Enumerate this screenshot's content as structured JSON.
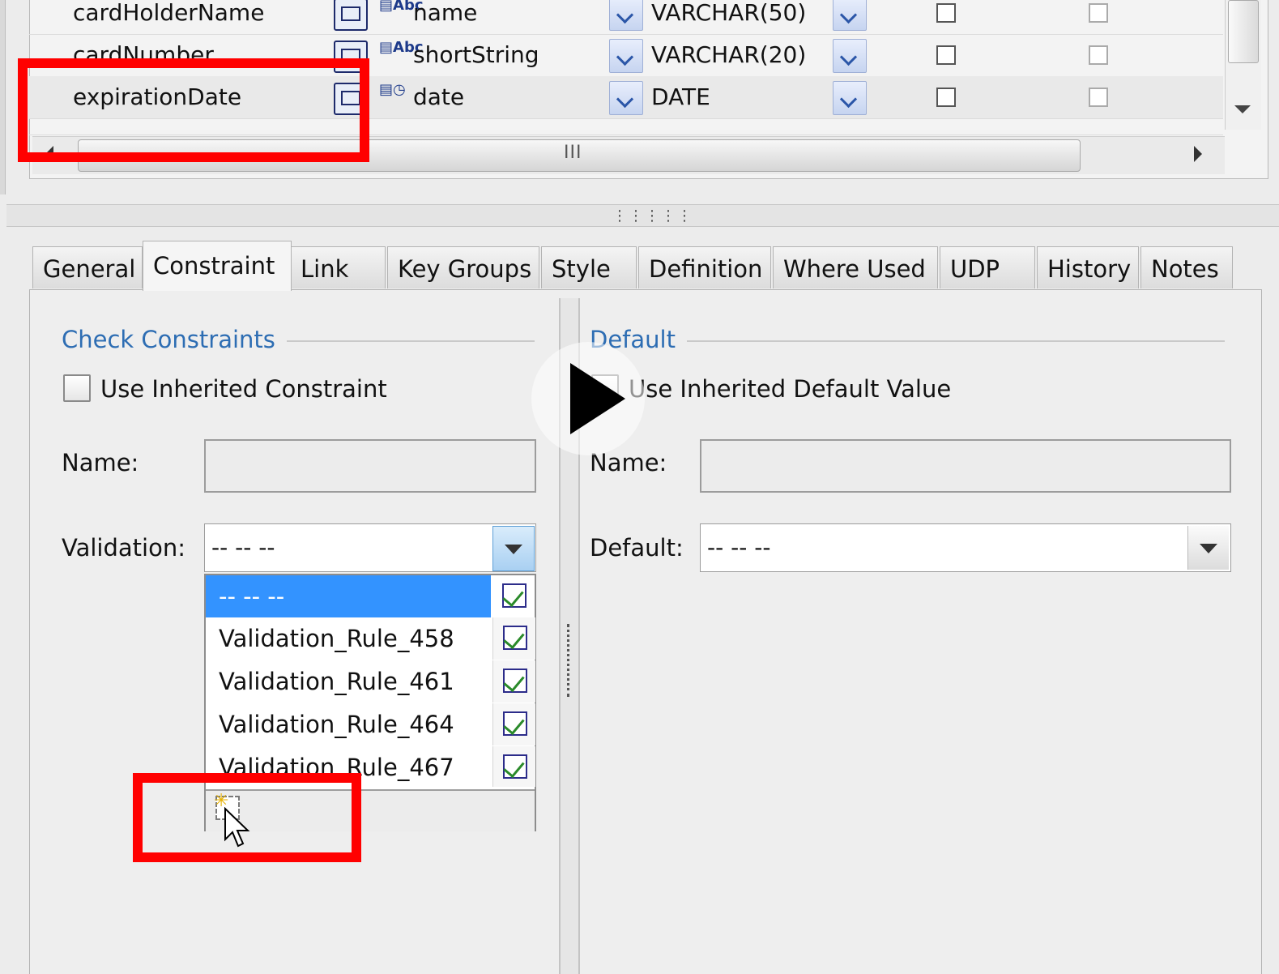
{
  "grid": {
    "rows": [
      {
        "name": "cardHolderName",
        "domain": "name",
        "datatype": "VARCHAR(50)"
      },
      {
        "name": "cardNumber",
        "domain": "shortString",
        "datatype": "VARCHAR(20)"
      },
      {
        "name": "expirationDate",
        "domain": "date",
        "datatype": "DATE"
      }
    ],
    "hscroll_grip": "III"
  },
  "tabs": [
    "General",
    "Constraint",
    "Link",
    "Key Groups",
    "Style",
    "Definition",
    "Where Used",
    "UDP",
    "History",
    "Notes"
  ],
  "active_tab": "Constraint",
  "check_constraints": {
    "title": "Check Constraints",
    "inherit_label": "Use Inherited Constraint",
    "name_label": "Name:",
    "name_value": "",
    "validation_label": "Validation:",
    "validation_value": "-- -- --",
    "options": [
      "-- -- --",
      "Validation_Rule_458",
      "Validation_Rule_461",
      "Validation_Rule_464",
      "Validation_Rule_467"
    ]
  },
  "default": {
    "title": "Default",
    "inherit_label": "Use Inherited Default Value",
    "name_label": "Name:",
    "name_value": "",
    "default_label": "Default:",
    "default_value": "-- -- --"
  },
  "icons": [
    "column-icon",
    "domain-text-icon",
    "domain-date-icon",
    "dropdown-arrow-icon",
    "edit-rule-icon",
    "new-rule-icon",
    "mouse-cursor-icon",
    "play-icon"
  ],
  "colors": {
    "accent": "#2d6db3",
    "selection": "#3393ff",
    "annotation": "#ff0000"
  }
}
